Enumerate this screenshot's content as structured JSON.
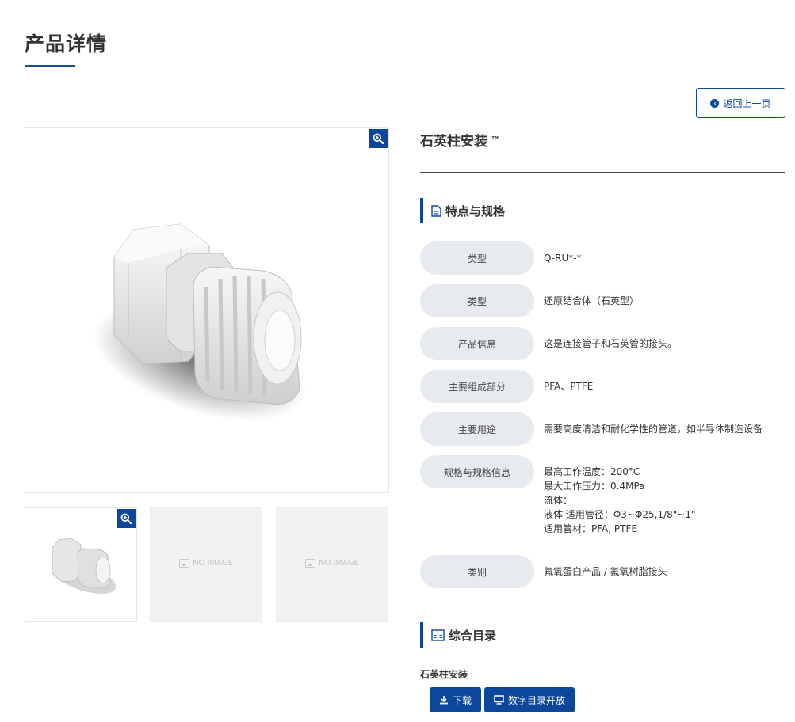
{
  "header": {
    "title": "产品详情"
  },
  "back_button": {
    "label": "返回上一页"
  },
  "gallery": {
    "no_image_label": "NO IMAGE"
  },
  "product": {
    "name": "石英柱安装",
    "trademark": "™"
  },
  "features": {
    "heading": "特点与规格",
    "rows": [
      {
        "label": "类型",
        "value": [
          "Q-RU*-*"
        ]
      },
      {
        "label": "类型",
        "value": [
          "还原结合体（石英型）"
        ]
      },
      {
        "label": "产品信息",
        "value": [
          "这是连接管子和石英管的接头。"
        ]
      },
      {
        "label": "主要组成部分",
        "value": [
          "PFA、PTFE"
        ]
      },
      {
        "label": "主要用途",
        "value": [
          "需要高度清洁和耐化学性的管道，如半导体制造设备"
        ]
      },
      {
        "label": "规格与规格信息",
        "value": [
          "最高工作温度：200°C",
          "最大工作压力：0.4MPa",
          "流体：",
          "液体 适用管径：Φ3~Φ25,1/8\"~1\"",
          "适用管材：PFA, PTFE"
        ]
      },
      {
        "label": "类别",
        "value": [
          "氟氧蛋白产品 / 氟氧树脂接头"
        ]
      }
    ]
  },
  "catalog": {
    "heading": "综合目录",
    "item_name": "石英柱安装",
    "download_label": "下载",
    "digital_label": "数字目录开放"
  },
  "colors": {
    "accent": "#0d479c",
    "label_bg": "#e7eaee",
    "title_underline": "#1f4e8c"
  }
}
